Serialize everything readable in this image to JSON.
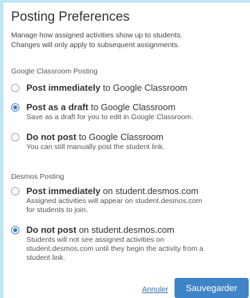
{
  "dialog": {
    "title": "Posting Preferences",
    "description_line1": "Manage how assigned activities show up to students.",
    "description_line2": "Changes will only apply to subsequent assignments."
  },
  "google_section": {
    "label": "Google Classroom Posting",
    "options": [
      {
        "bold": "Post immediately",
        "rest": " to Google Classroom",
        "sub": "",
        "checked": false
      },
      {
        "bold": "Post as a draft",
        "rest": " to Google Classroom",
        "sub": "Save as a draft for you to edit in Google Classroom.",
        "checked": true
      },
      {
        "bold": "Do not post",
        "rest": " to Google Classroom",
        "sub": "You can still manually post the student link.",
        "checked": false
      }
    ]
  },
  "desmos_section": {
    "label": "Desmos Posting",
    "options": [
      {
        "bold": "Post immediately",
        "rest": " on student.desmos.com",
        "sub_line1": "Assigned activities will appear on student.desmos.com",
        "sub_line2": "for students to join.",
        "checked": false
      },
      {
        "bold": "Do not post",
        "rest": " on student.desmos.com",
        "sub_line1": "Students will not see assigned activities on",
        "sub_line2": "student.desmos.com until they begin the activity from a",
        "sub_line3": "student link.",
        "checked": true
      }
    ]
  },
  "footer": {
    "cancel_label": "Annuler",
    "save_label": "Sauvegarder"
  },
  "colors": {
    "accent": "#3f84c6",
    "backdrop": "#bfe6f7"
  }
}
